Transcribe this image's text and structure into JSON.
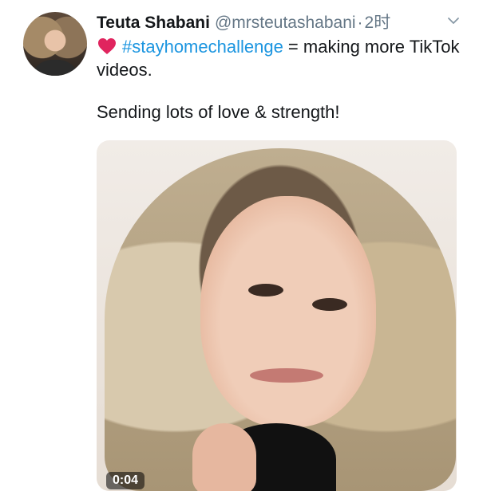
{
  "tweet": {
    "author": {
      "name": "Teuta Shabani",
      "handle": "@mrsteutashabani",
      "separator": "·",
      "time": "2时"
    },
    "body": {
      "hashtag": "#stayhomechallenge",
      "text_after_hashtag": " = making more TikTok videos.",
      "second_paragraph": "Sending lots of love & strength!"
    },
    "media": {
      "duration": "0:04"
    }
  },
  "icons": {
    "heart": "red-heart-emoji",
    "chevron": "chevron-down-icon"
  },
  "colors": {
    "hashtag": "#1b95e0",
    "text": "#14171a",
    "secondary": "#657786",
    "heart": "#e0245e"
  }
}
